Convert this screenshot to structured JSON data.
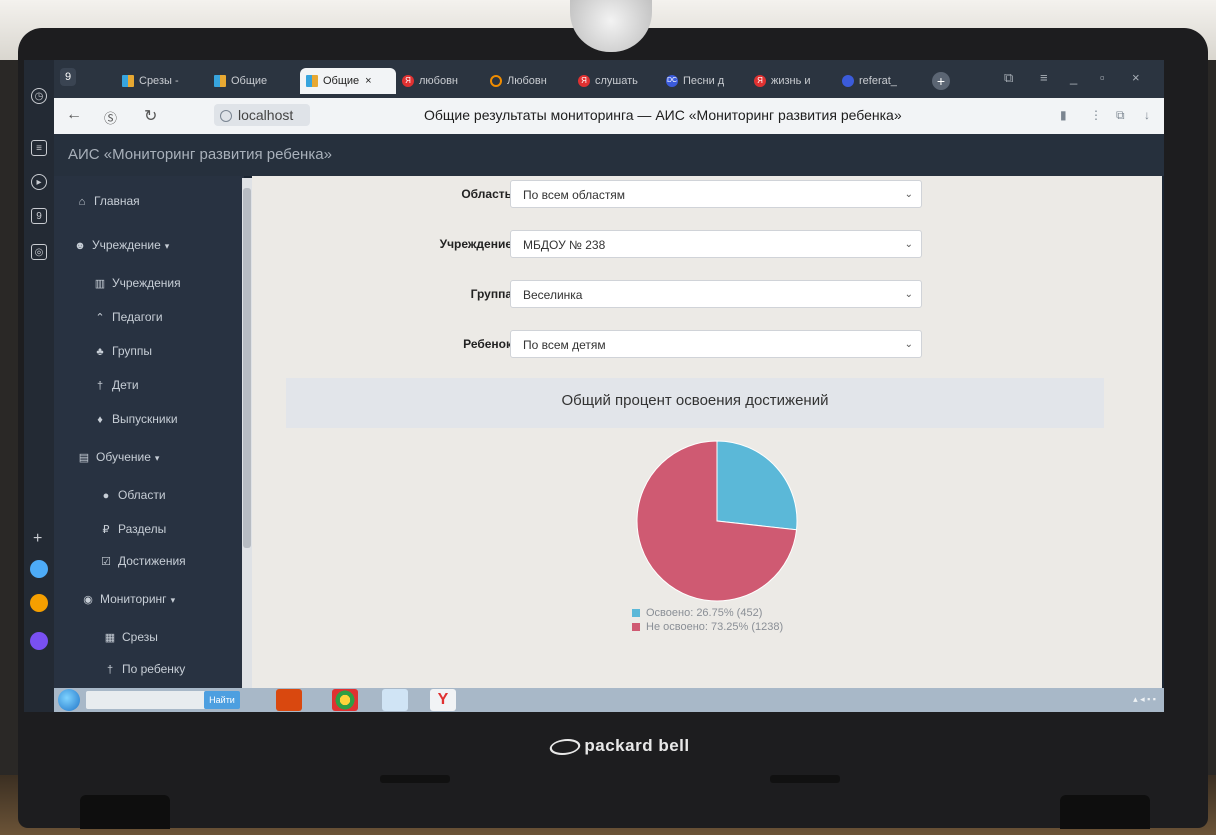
{
  "browser": {
    "tabs": [
      {
        "label": "Срезы -",
        "icon": "grid-favicon"
      },
      {
        "label": "Общие",
        "icon": "grid-favicon"
      },
      {
        "label": "Общие",
        "icon": "grid-favicon",
        "active": true
      },
      {
        "label": "любовн",
        "icon": "yandex-favicon"
      },
      {
        "label": "Любовн",
        "icon": "ok-favicon"
      },
      {
        "label": "слушать",
        "icon": "yandex-favicon"
      },
      {
        "label": "Песни д",
        "icon": "site-favicon"
      },
      {
        "label": "жизнь и",
        "icon": "yandex-favicon"
      },
      {
        "label": "referat_",
        "icon": "doc-favicon"
      }
    ],
    "url": "localhost",
    "page_title": "Общие результаты мониторинга — АИС «Мониторинг развития ребенка»"
  },
  "app": {
    "title": "АИС «Мониторинг развития ребенка»"
  },
  "sidebar": {
    "items": [
      {
        "label": "Главная",
        "icon": "home-icon",
        "level": 0
      },
      {
        "label": "Учреждение",
        "icon": "users-icon",
        "level": 0,
        "expandable": true
      },
      {
        "label": "Учреждения",
        "icon": "bank-icon",
        "level": 1
      },
      {
        "label": "Педагоги",
        "icon": "graduation-cap-icon",
        "level": 1
      },
      {
        "label": "Группы",
        "icon": "sitemap-icon",
        "level": 1
      },
      {
        "label": "Дети",
        "icon": "child-icon",
        "level": 1
      },
      {
        "label": "Выпускники",
        "icon": "person-icon",
        "level": 1
      },
      {
        "label": "Обучение",
        "icon": "book-icon",
        "level": 0,
        "expandable": true
      },
      {
        "label": "Области",
        "icon": "circle-icon",
        "level": 1
      },
      {
        "label": "Разделы",
        "icon": "ruble-icon",
        "level": 1
      },
      {
        "label": "Достижения",
        "icon": "check-square-icon",
        "level": 1
      },
      {
        "label": "Мониторинг",
        "icon": "eye-icon",
        "level": 0,
        "expandable": true
      },
      {
        "label": "Срезы",
        "icon": "calendar-icon",
        "level": 1
      },
      {
        "label": "По ребенку",
        "icon": "child-icon",
        "level": 1
      }
    ]
  },
  "filters": {
    "area": {
      "label": "Область",
      "value": "По всем областям"
    },
    "institution": {
      "label": "Учреждение",
      "value": "МБДОУ № 238"
    },
    "group": {
      "label": "Группа",
      "value": "Веселинка"
    },
    "child": {
      "label": "Ребенок",
      "value": "По всем детям"
    }
  },
  "chart_data": {
    "type": "pie",
    "title": "Общий процент освоения достижений",
    "categories": [
      "Освоено",
      "Не освоено"
    ],
    "values": [
      452,
      1238
    ],
    "percents": [
      26.75,
      73.25
    ],
    "colors": [
      "#5bb8d8",
      "#cf5a72"
    ],
    "legend_labels": [
      "Освоено: 26.75% (452)",
      "Не освоено: 73.25% (1238)"
    ],
    "legend_position": "bottom"
  },
  "taskbar": {
    "search_button": "Найти"
  },
  "device": {
    "brand": "packard bell"
  }
}
